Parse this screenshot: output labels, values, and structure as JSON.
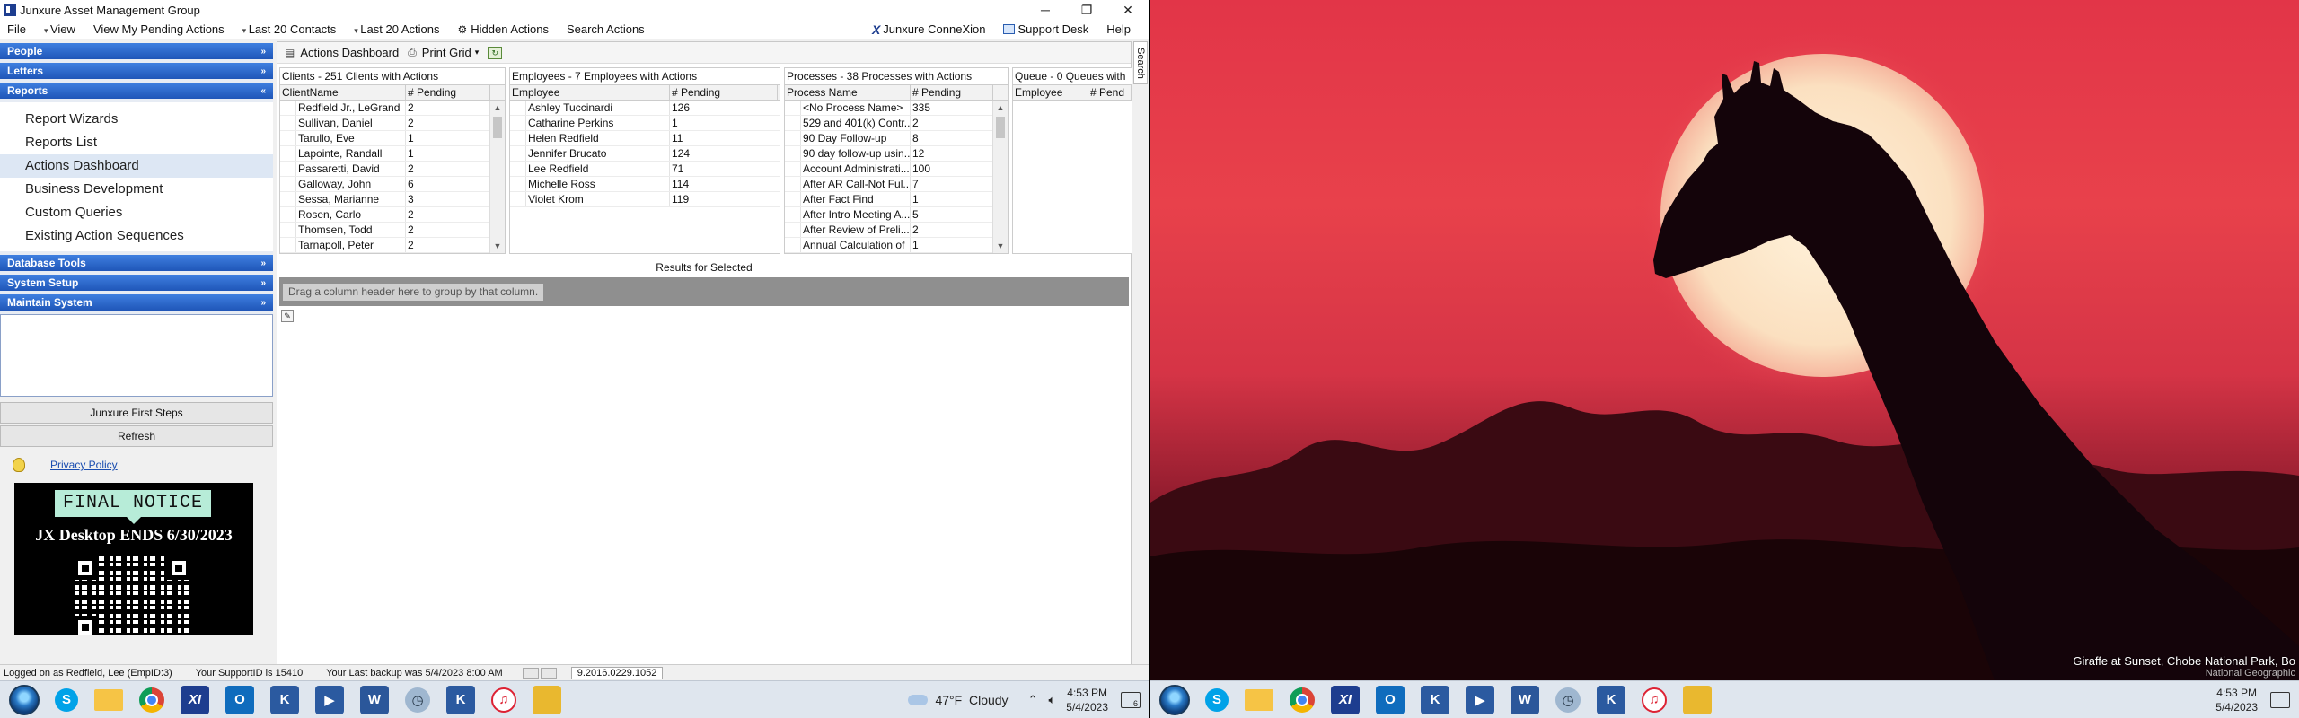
{
  "window": {
    "title": "Junxure Asset Management Group",
    "controls": [
      "─",
      "❐",
      "✕"
    ]
  },
  "menu": {
    "items": [
      "File",
      "View",
      "View My Pending Actions",
      "Last 20 Contacts",
      "Last 20 Actions",
      "Hidden Actions",
      "Search Actions"
    ],
    "right": [
      "Junxure ConneXion",
      "Support Desk",
      "Help"
    ]
  },
  "nav": {
    "sections": [
      "People",
      "Letters",
      "Reports",
      "Database Tools",
      "System Setup",
      "Maintain System"
    ],
    "reports_items": [
      "Report Wizards",
      "Reports List",
      "Actions Dashboard",
      "Business Development",
      "Custom Queries",
      "Existing Action Sequences"
    ],
    "active_item": "Actions Dashboard",
    "first_steps": "Junxure First Steps",
    "refresh": "Refresh",
    "privacy": "Privacy Policy",
    "notice_title": "FINAL NOTICE",
    "notice_body": "JX Desktop ENDS 6/30/2023"
  },
  "toolbar": {
    "dashboard": "Actions Dashboard",
    "print": "Print Grid"
  },
  "clients": {
    "title": "Clients  -  251 Clients with Actions",
    "col_name": "ClientName",
    "col_pending": "# Pending",
    "rows": [
      [
        "Redfield Jr., LeGrand",
        "2"
      ],
      [
        "Sullivan, Daniel",
        "2"
      ],
      [
        "Tarullo, Eve",
        "1"
      ],
      [
        "Lapointe, Randall",
        "1"
      ],
      [
        "Passaretti, David",
        "2"
      ],
      [
        "Galloway, John",
        "6"
      ],
      [
        "Sessa, Marianne",
        "3"
      ],
      [
        "Rosen, Carlo",
        "2"
      ],
      [
        "Thomsen, Todd",
        "2"
      ],
      [
        "Tarnapoll, Peter",
        "2"
      ]
    ]
  },
  "employees": {
    "title": "Employees  -  7 Employees with Actions",
    "col_name": "Employee",
    "col_pending": "# Pending",
    "rows": [
      [
        "Ashley Tuccinardi",
        "126"
      ],
      [
        "Catharine Perkins",
        "1"
      ],
      [
        "Helen Redfield",
        "11"
      ],
      [
        "Jennifer Brucato",
        "124"
      ],
      [
        "Lee Redfield",
        "71"
      ],
      [
        "Michelle Ross",
        "114"
      ],
      [
        "Violet Krom",
        "119"
      ]
    ]
  },
  "processes": {
    "title": "Processes  -  38 Processes with Actions",
    "col_name": "Process Name",
    "col_pending": "# Pending",
    "rows": [
      [
        "<No Process Name>",
        "335"
      ],
      [
        "529 and 401(k) Contr...",
        "2"
      ],
      [
        "90 Day Follow-up",
        "8"
      ],
      [
        "90 day follow-up usin...",
        "12"
      ],
      [
        "Account Administrati...",
        "100"
      ],
      [
        "After AR Call-Not Ful...",
        "7"
      ],
      [
        "After Fact Find",
        "1"
      ],
      [
        "After Intro Meeting A...",
        "5"
      ],
      [
        "After Review of Preli...",
        "2"
      ],
      [
        "Annual Calculation of",
        "1"
      ]
    ]
  },
  "queue": {
    "title": "Queue  -  0 Queues with",
    "col_name": "Employee",
    "col_pending": "# Pend"
  },
  "results": {
    "title": "Results for Selected",
    "group_hint": "Drag a column header here to group by that column."
  },
  "side_tab": "Search",
  "status": {
    "logged": "Logged on as Redfield, Lee (EmpID:3)",
    "support": "Your SupportID is 15410",
    "backup": "Your Last backup was 5/4/2023 8:00 AM",
    "version": "9.2016.0229.1052"
  },
  "wallpaper": {
    "caption": "Giraffe at Sunset, Chobe National Park, Bo",
    "sub": "National Geographic"
  },
  "taskbar": {
    "weather_temp": "47°F",
    "weather_text": "Cloudy",
    "time": "4:53 PM",
    "date": "5/4/2023",
    "notif_count": "6",
    "icons": [
      "skype-icon",
      "file-explorer-icon",
      "chrome-icon",
      "junxure-icon",
      "outlook-icon",
      "k-app-icon",
      "media-app-icon",
      "word-icon",
      "clock-app-icon",
      "k-app-icon",
      "itunes-icon",
      "folder-icon"
    ]
  },
  "colors": {
    "nav_header": "#2f6ad0",
    "sky": "#e23548",
    "sun": "#fbe6c8"
  }
}
